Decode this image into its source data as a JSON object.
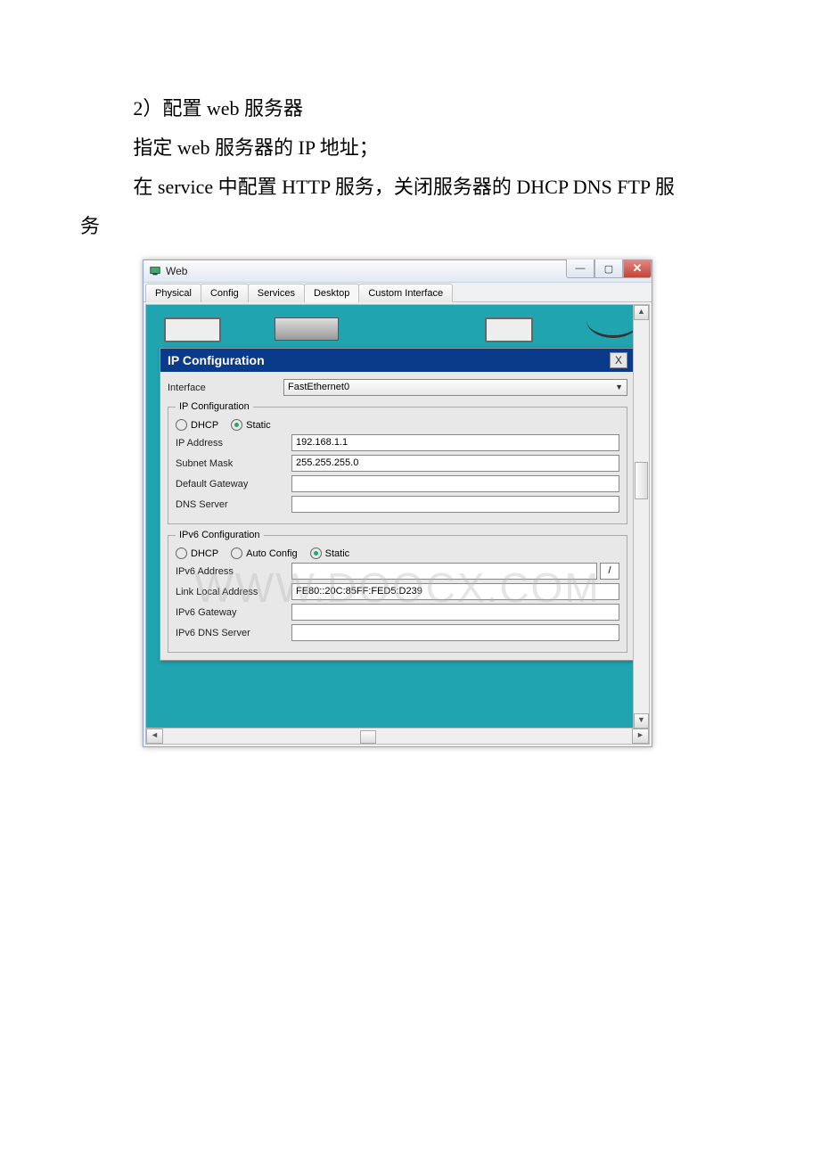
{
  "doc": {
    "line1": "2）配置 web 服务器",
    "line2": "指定 web 服务器的 IP 地址；",
    "line3": "在 service 中配置 HTTP 服务，关闭服务器的 DHCP DNS FTP 服",
    "line4": "务"
  },
  "window": {
    "title": "Web",
    "tabs": [
      "Physical",
      "Config",
      "Services",
      "Desktop",
      "Custom Interface"
    ],
    "active_tab": "Desktop"
  },
  "ip_panel": {
    "title": "IP Configuration",
    "close": "X",
    "interface_label": "Interface",
    "interface_value": "FastEthernet0",
    "group4": {
      "legend": "IP Configuration",
      "radios": {
        "dhcp": "DHCP",
        "static": "Static"
      },
      "selected": "static",
      "fields": {
        "ip_label": "IP Address",
        "ip_value": "192.168.1.1",
        "mask_label": "Subnet Mask",
        "mask_value": "255.255.255.0",
        "gw_label": "Default Gateway",
        "gw_value": "",
        "dns_label": "DNS Server",
        "dns_value": ""
      }
    },
    "group6": {
      "legend": "IPv6 Configuration",
      "radios": {
        "dhcp": "DHCP",
        "auto": "Auto Config",
        "static": "Static"
      },
      "selected": "static",
      "fields": {
        "addr_label": "IPv6 Address",
        "addr_value": "",
        "prefix": "/",
        "ll_label": "Link Local Address",
        "ll_value": "FE80::20C:85FF:FED5:D239",
        "gw_label": "IPv6 Gateway",
        "gw_value": "",
        "dns_label": "IPv6 DNS Server",
        "dns_value": ""
      }
    }
  },
  "watermark": "WWW.DOOCX.COM"
}
